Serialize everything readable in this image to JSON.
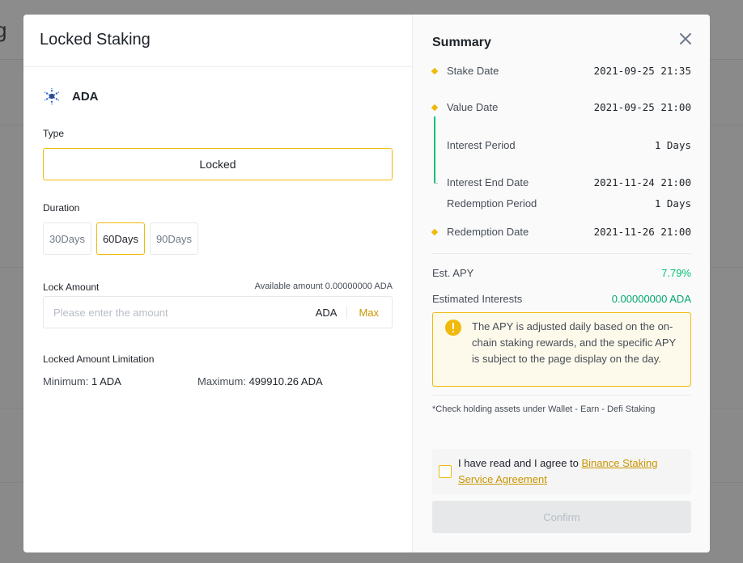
{
  "background": {
    "title": "g"
  },
  "modal": {
    "title": "Locked Staking",
    "coin": {
      "name": "ADA",
      "icon": "cardano-icon"
    },
    "type": {
      "label": "Type",
      "value": "Locked"
    },
    "duration": {
      "label": "Duration",
      "options": [
        {
          "label": "30Days",
          "selected": false
        },
        {
          "label": "60Days",
          "selected": true
        },
        {
          "label": "90Days",
          "selected": false
        }
      ]
    },
    "lock_amount": {
      "label": "Lock Amount",
      "available": "Available amount 0.00000000 ADA",
      "placeholder": "Please enter the amount",
      "unit": "ADA",
      "max_label": "Max"
    },
    "limitation": {
      "label": "Locked Amount Limitation",
      "minimum_label": "Minimum:",
      "minimum_value": "1 ADA",
      "maximum_label": "Maximum:",
      "maximum_value": "499910.26 ADA"
    }
  },
  "summary": {
    "title": "Summary",
    "rows": {
      "stake_date": {
        "label": "Stake Date",
        "value": "2021-09-25 21:35"
      },
      "value_date": {
        "label": "Value Date",
        "value": "2021-09-25 21:00"
      },
      "interest_period": {
        "label": "Interest Period",
        "value": "1 Days"
      },
      "interest_end_date": {
        "label": "Interest End Date",
        "value": "2021-11-24 21:00"
      },
      "redemption_period": {
        "label": "Redemption Period",
        "value": "1 Days"
      },
      "redemption_date": {
        "label": "Redemption Date",
        "value": "2021-11-26 21:00"
      }
    },
    "est_apy": {
      "label": "Est. APY",
      "value": "7.79%"
    },
    "est_interests": {
      "label": "Estimated Interests",
      "value": "0.00000000 ADA"
    },
    "notice": "The APY is adjusted daily based on the on-chain staking rewards, and the specific APY is subject to the page display on the day.",
    "check_note": "*Check holding assets under Wallet - Earn - Defi Staking",
    "agreement": {
      "prefix": "I have read and I agree to ",
      "link": "Binance Staking Service Agreement",
      "checked": false
    },
    "confirm_label": "Confirm"
  },
  "colors": {
    "accent": "#f0b90b",
    "green": "#02c076",
    "link": "#c99400"
  }
}
